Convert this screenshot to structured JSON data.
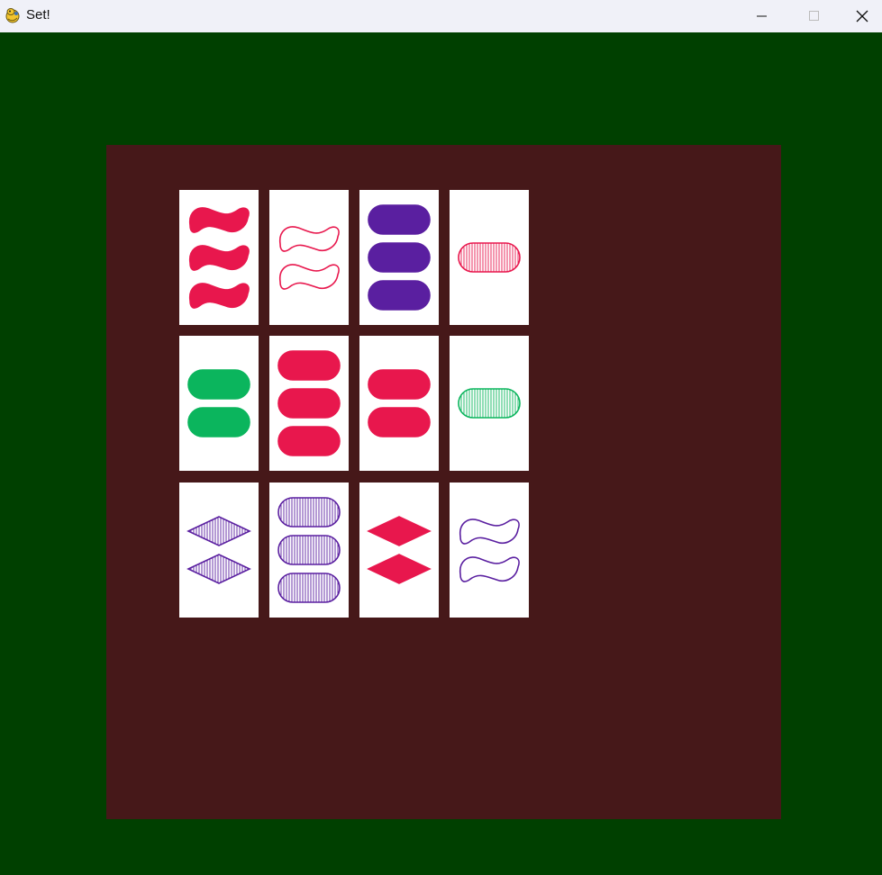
{
  "window": {
    "title": "Set!",
    "app_icon": "python-snake-icon",
    "controls": [
      "minimize-icon",
      "maximize-icon",
      "close-icon"
    ]
  },
  "colors": {
    "felt": "#004000",
    "board": "#461819",
    "red": "#e8174d",
    "purple": "#5a1fa0",
    "green": "#0bb55d"
  },
  "cards": [
    {
      "row": 1,
      "col": 1,
      "number": 3,
      "shape": "squiggle",
      "color": "red",
      "shading": "solid"
    },
    {
      "row": 1,
      "col": 2,
      "number": 2,
      "shape": "squiggle",
      "color": "red",
      "shading": "open"
    },
    {
      "row": 1,
      "col": 3,
      "number": 3,
      "shape": "oval",
      "color": "purple",
      "shading": "solid"
    },
    {
      "row": 1,
      "col": 4,
      "number": 1,
      "shape": "oval",
      "color": "red",
      "shading": "striped"
    },
    {
      "row": 2,
      "col": 1,
      "number": 2,
      "shape": "oval",
      "color": "green",
      "shading": "solid"
    },
    {
      "row": 2,
      "col": 2,
      "number": 3,
      "shape": "oval",
      "color": "red",
      "shading": "solid"
    },
    {
      "row": 2,
      "col": 3,
      "number": 2,
      "shape": "oval",
      "color": "red",
      "shading": "solid"
    },
    {
      "row": 2,
      "col": 4,
      "number": 1,
      "shape": "oval",
      "color": "green",
      "shading": "striped"
    },
    {
      "row": 3,
      "col": 1,
      "number": 2,
      "shape": "diamond",
      "color": "purple",
      "shading": "striped"
    },
    {
      "row": 3,
      "col": 2,
      "number": 3,
      "shape": "oval",
      "color": "purple",
      "shading": "striped"
    },
    {
      "row": 3,
      "col": 3,
      "number": 2,
      "shape": "diamond",
      "color": "red",
      "shading": "solid"
    },
    {
      "row": 3,
      "col": 4,
      "number": 2,
      "shape": "squiggle",
      "color": "purple",
      "shading": "open"
    }
  ]
}
